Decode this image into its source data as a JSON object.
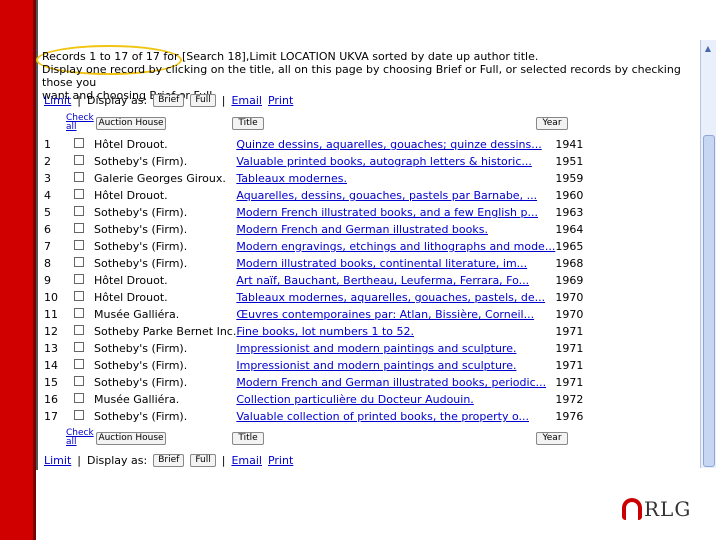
{
  "header": {
    "line1": "Records 1 to 17 of 17 for [Search 18],Limit LOCATION UKVA sorted by date up author title.",
    "line2": "Display one record by clicking on the title, all on this page by choosing Brief or Full, or selected records by checking those you",
    "line3": "want and choosing Brief or Full."
  },
  "toolbar": {
    "limit": "Limit",
    "display_as": "Display as:",
    "brief": "Brief",
    "full": "Full",
    "email": "Email",
    "print": "Print",
    "sep": "|"
  },
  "columns": {
    "check": "Check all",
    "auction_house": "Auction House",
    "title": "Title",
    "year": "Year"
  },
  "rows": [
    {
      "n": "1",
      "house": "Hôtel Drouot.",
      "title": "Quinze dessins, aquarelles, gouaches; quinze dessins...",
      "year": "1941"
    },
    {
      "n": "2",
      "house": "Sotheby's (Firm).",
      "title": "Valuable printed books, autograph letters & historic...",
      "year": "1951"
    },
    {
      "n": "3",
      "house": "Galerie Georges Giroux.",
      "title": "Tableaux modernes.",
      "year": "1959"
    },
    {
      "n": "4",
      "house": "Hôtel Drouot.",
      "title": "Aquarelles, dessins, gouaches, pastels par Barnabe, ...",
      "year": "1960"
    },
    {
      "n": "5",
      "house": "Sotheby's (Firm).",
      "title": "Modern French illustrated books, and a few English p...",
      "year": "1963"
    },
    {
      "n": "6",
      "house": "Sotheby's (Firm).",
      "title": "Modern French and German illustrated books.",
      "year": "1964"
    },
    {
      "n": "7",
      "house": "Sotheby's (Firm).",
      "title": "Modern engravings, etchings and lithographs and mode...",
      "year": "1965"
    },
    {
      "n": "8",
      "house": "Sotheby's (Firm).",
      "title": "Modern illustrated books, continental literature, im...",
      "year": "1968"
    },
    {
      "n": "9",
      "house": "Hôtel Drouot.",
      "title": "Art naïf, Bauchant, Bertheau, Leuferma, Ferrara, Fo...",
      "year": "1969"
    },
    {
      "n": "10",
      "house": "Hôtel Drouot.",
      "title": "Tableaux modernes, aquarelles, gouaches, pastels, de...",
      "year": "1970"
    },
    {
      "n": "11",
      "house": "Musée Galliéra.",
      "title": "Œuvres contemporaines par: Atlan, Bissière, Corneil...",
      "year": "1970"
    },
    {
      "n": "12",
      "house": "Sotheby Parke Bernet Inc.",
      "title": "Fine books, lot numbers 1 to 52.",
      "year": "1971"
    },
    {
      "n": "13",
      "house": "Sotheby's (Firm).",
      "title": "Impressionist and modern paintings and sculpture.",
      "year": "1971"
    },
    {
      "n": "14",
      "house": "Sotheby's (Firm).",
      "title": "Impressionist and modern paintings and sculpture.",
      "year": "1971"
    },
    {
      "n": "15",
      "house": "Sotheby's (Firm).",
      "title": "Modern French and German illustrated books, periodic...",
      "year": "1971"
    },
    {
      "n": "16",
      "house": "Musée Galliéra.",
      "title": "Collection particulière du Docteur Audouin.",
      "year": "1972"
    },
    {
      "n": "17",
      "house": "Sotheby's (Firm).",
      "title": "Valuable collection of printed books, the property o...",
      "year": "1976"
    }
  ],
  "logo": {
    "text": "RLG"
  },
  "colors": {
    "accent_red": "#d00000",
    "link": "#0000cc",
    "highlight_oval": "#f1c40f"
  }
}
